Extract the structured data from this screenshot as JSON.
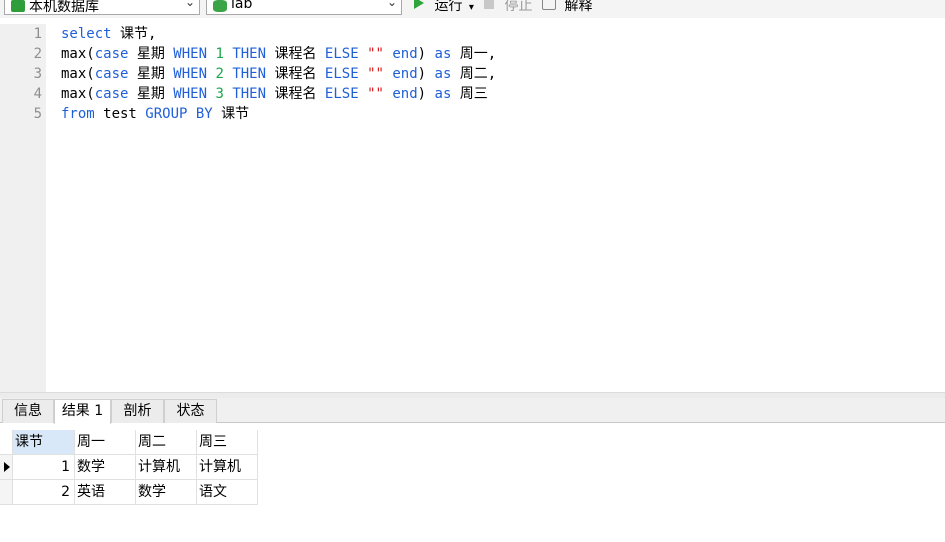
{
  "toolbar": {
    "connection": "本机数据库",
    "database": "lab",
    "run_label": "运行",
    "stop_label": "停止",
    "explain_label": "解释"
  },
  "editor": {
    "line_numbers": [
      "1",
      "2",
      "3",
      "4",
      "5"
    ],
    "lines": [
      [
        {
          "t": "select",
          "c": "kw"
        },
        {
          "t": " 课节,",
          "c": "fn"
        }
      ],
      [
        {
          "t": "max(",
          "c": "fn"
        },
        {
          "t": "case",
          "c": "kw"
        },
        {
          "t": " 星期 ",
          "c": "fn"
        },
        {
          "t": "WHEN",
          "c": "kw"
        },
        {
          "t": " ",
          "c": "fn"
        },
        {
          "t": "1",
          "c": "num"
        },
        {
          "t": " ",
          "c": "fn"
        },
        {
          "t": "THEN",
          "c": "kw"
        },
        {
          "t": " 课程名 ",
          "c": "fn"
        },
        {
          "t": "ELSE",
          "c": "kw"
        },
        {
          "t": " ",
          "c": "fn"
        },
        {
          "t": "\"\"",
          "c": "str"
        },
        {
          "t": " ",
          "c": "fn"
        },
        {
          "t": "end",
          "c": "kw"
        },
        {
          "t": ") ",
          "c": "fn"
        },
        {
          "t": "as",
          "c": "kw"
        },
        {
          "t": " 周一,",
          "c": "fn"
        }
      ],
      [
        {
          "t": "max(",
          "c": "fn"
        },
        {
          "t": "case",
          "c": "kw"
        },
        {
          "t": " 星期 ",
          "c": "fn"
        },
        {
          "t": "WHEN",
          "c": "kw"
        },
        {
          "t": " ",
          "c": "fn"
        },
        {
          "t": "2",
          "c": "num"
        },
        {
          "t": " ",
          "c": "fn"
        },
        {
          "t": "THEN",
          "c": "kw"
        },
        {
          "t": " 课程名 ",
          "c": "fn"
        },
        {
          "t": "ELSE",
          "c": "kw"
        },
        {
          "t": " ",
          "c": "fn"
        },
        {
          "t": "\"\"",
          "c": "str"
        },
        {
          "t": " ",
          "c": "fn"
        },
        {
          "t": "end",
          "c": "kw"
        },
        {
          "t": ") ",
          "c": "fn"
        },
        {
          "t": "as",
          "c": "kw"
        },
        {
          "t": " 周二,",
          "c": "fn"
        }
      ],
      [
        {
          "t": "max(",
          "c": "fn"
        },
        {
          "t": "case",
          "c": "kw"
        },
        {
          "t": " 星期 ",
          "c": "fn"
        },
        {
          "t": "WHEN",
          "c": "kw"
        },
        {
          "t": " ",
          "c": "fn"
        },
        {
          "t": "3",
          "c": "num"
        },
        {
          "t": " ",
          "c": "fn"
        },
        {
          "t": "THEN",
          "c": "kw"
        },
        {
          "t": " 课程名 ",
          "c": "fn"
        },
        {
          "t": "ELSE",
          "c": "kw"
        },
        {
          "t": " ",
          "c": "fn"
        },
        {
          "t": "\"\"",
          "c": "str"
        },
        {
          "t": " ",
          "c": "fn"
        },
        {
          "t": "end",
          "c": "kw"
        },
        {
          "t": ") ",
          "c": "fn"
        },
        {
          "t": "as",
          "c": "kw"
        },
        {
          "t": " 周三",
          "c": "fn"
        }
      ],
      [
        {
          "t": "from",
          "c": "kw"
        },
        {
          "t": " test ",
          "c": "fn"
        },
        {
          "t": "GROUP BY",
          "c": "kw"
        },
        {
          "t": " 课节",
          "c": "fn"
        }
      ]
    ]
  },
  "tabs": [
    {
      "label": "信息",
      "active": false
    },
    {
      "label": "结果 1",
      "active": true
    },
    {
      "label": "剖析",
      "active": false
    },
    {
      "label": "状态",
      "active": false
    }
  ],
  "results": {
    "columns": [
      "课节",
      "周一",
      "周二",
      "周三"
    ],
    "rows": [
      [
        "1",
        "数学",
        "计算机",
        "计算机"
      ],
      [
        "2",
        "英语",
        "数学",
        "语文"
      ]
    ]
  },
  "colors": {
    "keyword": "#1f5fd8",
    "number": "#1aa64b",
    "string": "#d81e1e",
    "run": "#2ea43a"
  }
}
